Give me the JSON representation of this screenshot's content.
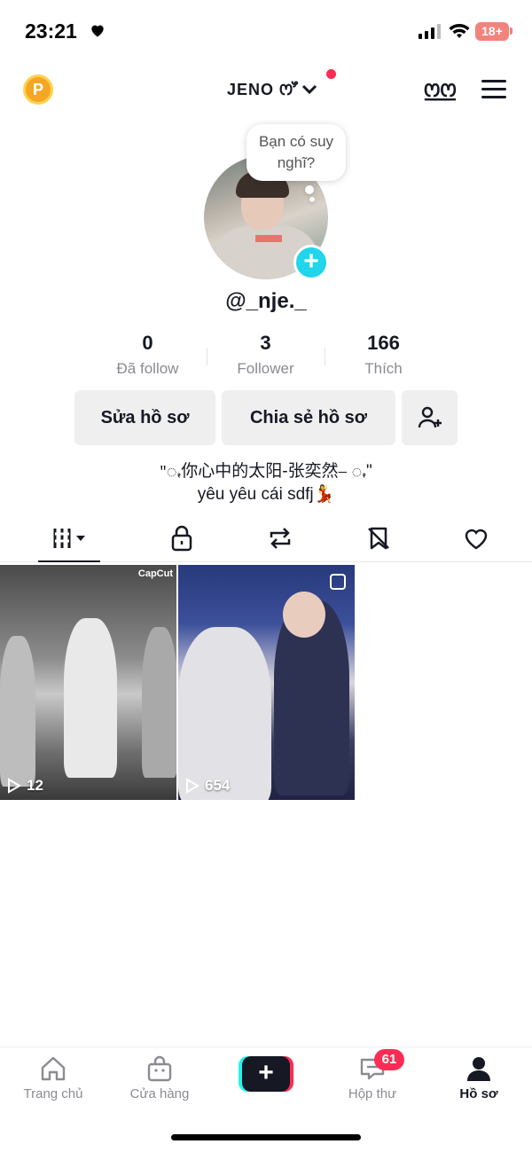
{
  "status_bar": {
    "time": "23:21",
    "battery": "18+"
  },
  "header": {
    "account_name": "JENO ꯁꯧ",
    "coin_label": "P",
    "icon_a_label": "ꯁ꯭ꯁ"
  },
  "profile": {
    "thought_bubble": "Bạn có suy nghĩ?",
    "username": "@_nje._",
    "stats": [
      {
        "value": "0",
        "label": "Đã follow"
      },
      {
        "value": "3",
        "label": "Follower"
      },
      {
        "value": "166",
        "label": "Thích"
      }
    ],
    "actions": {
      "edit": "Sửa hồ sơ",
      "share": "Chia sẻ hồ sơ"
    },
    "bio_line1": "\"ꩻ你心中的太阳-张奕然⎯ ꩻ\"",
    "bio_line2": "yêu yêu cái sdfj💃"
  },
  "videos": [
    {
      "plays": "12",
      "watermark": "CapCut"
    },
    {
      "plays": "654"
    }
  ],
  "bottom_nav": {
    "home": "Trang chủ",
    "shop": "Cửa hàng",
    "inbox": "Hộp thư",
    "inbox_badge": "61",
    "profile": "Hồ sơ"
  },
  "colors": {
    "accent": "#fe2c55",
    "cyan": "#25f4ee",
    "text": "#161823",
    "muted": "#8a8b91"
  }
}
